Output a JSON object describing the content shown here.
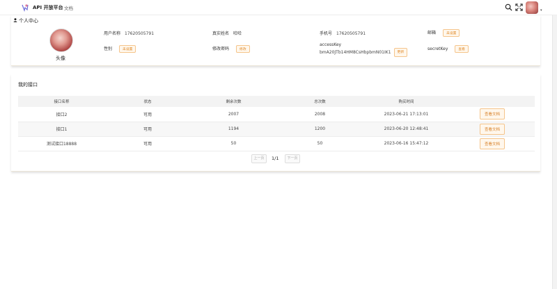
{
  "topbar": {
    "brand": "API 开放平台",
    "nav_doc": "文档",
    "caret": "▾"
  },
  "profile": {
    "section_title": "个人中心",
    "avatar_label": "头像",
    "fields": {
      "username": {
        "label": "用户名称",
        "value": "17620505791"
      },
      "realname": {
        "label": "真实姓名",
        "value": "哈哈"
      },
      "phone": {
        "label": "手机号",
        "value": "17620505791"
      },
      "email": {
        "label": "邮箱",
        "tag": "未设置"
      },
      "gender": {
        "label": "性别",
        "tag": "未设置"
      },
      "password": {
        "label": "修改密码",
        "tag": "修改"
      },
      "accesskey": {
        "label": "accessKey",
        "value": "bmA20JTb14HM8CsHbpbmN01IK1",
        "tag": "更新"
      },
      "secretkey": {
        "label": "secretKey",
        "tag": "查看"
      }
    }
  },
  "apis": {
    "title": "我的接口",
    "columns": [
      "接口名称",
      "状态",
      "剩余次数",
      "总次数",
      "购买时间",
      ""
    ],
    "rows": [
      {
        "name": "接口2",
        "status": "可用",
        "remaining": "2007",
        "total": "2008",
        "time": "2023-06-21 17:13:01",
        "action": "查看文档"
      },
      {
        "name": "接口1",
        "status": "可用",
        "remaining": "1194",
        "total": "1200",
        "time": "2023-06-20 12:48:41",
        "action": "查看文档"
      },
      {
        "name": "测试接口18888",
        "status": "可用",
        "remaining": "50",
        "total": "50",
        "time": "2023-06-16 15:47:12",
        "action": "查看文档"
      }
    ],
    "pager": {
      "prev": "上一页",
      "current": "1/1",
      "next": "下一页"
    }
  },
  "colors": {
    "accent": "#e08a2a",
    "tag_bg": "#fff7ec",
    "tag_border": "#f5c48a",
    "header_bg": "#f3f3f3"
  },
  "icons": {
    "search": "search-icon",
    "fullscreen": "fullscreen-icon",
    "user": "user-icon",
    "logo": "logo-icon"
  }
}
